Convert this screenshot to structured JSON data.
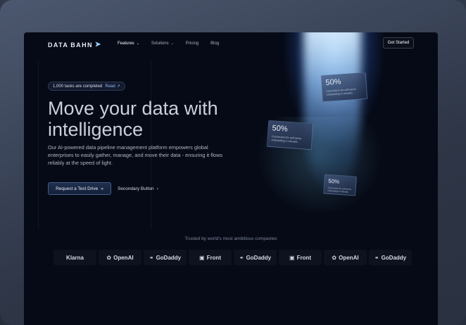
{
  "nav": {
    "logo_left": "DATA",
    "logo_right": "BAHN",
    "items": [
      {
        "label": "Features",
        "has_menu": true,
        "active": true
      },
      {
        "label": "Solutions",
        "has_menu": true,
        "active": false
      },
      {
        "label": "Pricing",
        "has_menu": false,
        "active": false
      },
      {
        "label": "Blog",
        "has_menu": false,
        "active": false
      }
    ],
    "cta_label": "Get Started"
  },
  "hero": {
    "badge_text": "1,000 tasks are completed",
    "badge_link": "Read",
    "title_line1": "Move your data with",
    "title_line2": "intelligence",
    "description": "Our AI-powered data pipeline management platform empowers global enterprises to easily gather, manage, and move their data - ensuring it flows reliably at the speed of light.",
    "primary_button": "Request a Test Drive",
    "secondary_button": "Secondary Button"
  },
  "stats": [
    {
      "value": "50%",
      "description": "Connectors for self-serve onboarding in minutes"
    },
    {
      "value": "50%",
      "description": "Connectors for self-serve onboarding in minutes"
    },
    {
      "value": "50%",
      "description": "Connectors for self-serve onboarding in minutes"
    }
  ],
  "trusted": {
    "heading": "Trusted by world's most ambitious companies",
    "logos": [
      "Klarna",
      "OpenAI",
      "GoDaddy",
      "Front",
      "GoDaddy",
      "Front",
      "OpenAI",
      "GoDaddy"
    ]
  },
  "colors": {
    "background": "#060a16",
    "accent": "#8fb8ff",
    "beam": "#b4d7ff"
  }
}
